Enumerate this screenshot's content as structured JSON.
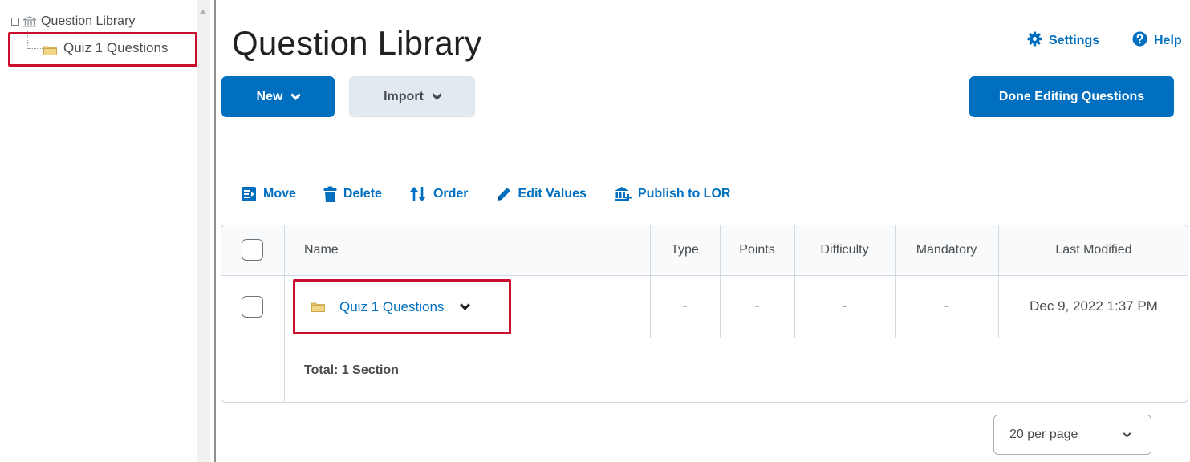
{
  "tree": {
    "root_label": "Question Library",
    "child_label": "Quiz 1 Questions"
  },
  "header": {
    "title": "Question Library",
    "settings_label": "Settings",
    "help_label": "Help"
  },
  "buttons": {
    "new_label": "New",
    "import_label": "Import",
    "done_label": "Done Editing Questions"
  },
  "toolbar": {
    "move": "Move",
    "delete": "Delete",
    "order": "Order",
    "edit_values": "Edit Values",
    "publish": "Publish to LOR"
  },
  "table": {
    "columns": [
      "Name",
      "Type",
      "Points",
      "Difficulty",
      "Mandatory",
      "Last Modified"
    ],
    "rows": [
      {
        "name": "Quiz 1 Questions",
        "type": "-",
        "points": "-",
        "difficulty": "-",
        "mandatory": "-",
        "last_modified": "Dec 9, 2022 1:37 PM"
      }
    ],
    "total": "Total:  1 Section"
  },
  "pager": {
    "per_page": "20 per page"
  },
  "colors": {
    "accent": "#006fbf",
    "highlight_box": "#c8102e",
    "folder": "#e7c46a"
  },
  "icons": [
    "tree-expander-icon",
    "library-icon",
    "folder-icon",
    "gear-icon",
    "help-icon",
    "chevron-down-icon",
    "move-icon",
    "trash-icon",
    "order-icon",
    "pencil-icon",
    "publish-icon"
  ]
}
